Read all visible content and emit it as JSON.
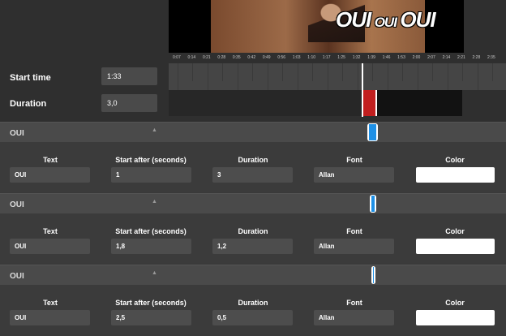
{
  "preview": {
    "caption_parts": [
      "OUI",
      "OUI",
      "OUI"
    ]
  },
  "controls": {
    "start_time_label": "Start time",
    "start_time_value": "1:33",
    "duration_label": "Duration",
    "duration_value": "3,0"
  },
  "timeline": {
    "ticks": [
      "0:07",
      "0:14",
      "0:21",
      "0:28",
      "0:35",
      "0:42",
      "0:49",
      "0:56",
      "1:03",
      "1:10",
      "1:17",
      "1:25",
      "1:32",
      "1:39",
      "1:46",
      "1:53",
      "2:00",
      "2:07",
      "2:14",
      "2:21",
      "2:28",
      "2:35"
    ],
    "playhead_fraction": 0.573,
    "segment_fraction_start": 0.573,
    "segment_fraction_end": 0.617
  },
  "columns": {
    "text": "Text",
    "start_after": "Start after (seconds)",
    "duration": "Duration",
    "font": "Font",
    "color": "Color"
  },
  "texts": [
    {
      "title": "OUI",
      "text": "OUI",
      "start_after": "1",
      "duration": "3",
      "font": "Allan",
      "color": "#ffffff",
      "marker_fraction_start": 0.59,
      "marker_fraction_end": 0.62
    },
    {
      "title": "OUI",
      "text": "OUI",
      "start_after": "1,8",
      "duration": "1,2",
      "font": "Allan",
      "color": "#ffffff",
      "marker_fraction_start": 0.596,
      "marker_fraction_end": 0.616
    },
    {
      "title": "OUI",
      "text": "OUI",
      "start_after": "2,5",
      "duration": "0,5",
      "font": "Allan",
      "color": "#ffffff",
      "marker_fraction_start": 0.6,
      "marker_fraction_end": 0.614
    }
  ],
  "accent": "#c21f1f",
  "marker_color": "#1e90e6"
}
